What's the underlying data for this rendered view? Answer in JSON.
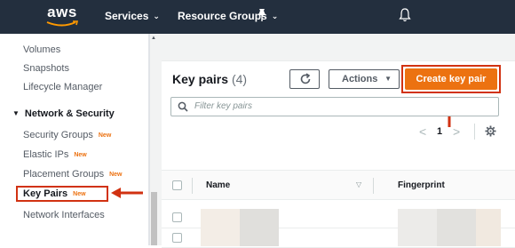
{
  "topnav": {
    "logo_text": "aws",
    "services_label": "Services",
    "resource_groups_label": "Resource Groups",
    "caret": "⌄",
    "background": "#232f3e",
    "pin_icon": "pin-icon",
    "bell_icon": "bell-icon"
  },
  "sidebar": {
    "items_top": [
      "Volumes",
      "Snapshots",
      "Lifecycle Manager"
    ],
    "section_label": "Network & Security",
    "section_toggle": "▼",
    "security_groups": {
      "label": "Security Groups",
      "badge": "New"
    },
    "elastic_ips": {
      "label": "Elastic IPs",
      "badge": "New"
    },
    "placement_groups": {
      "label": "Placement Groups",
      "badge": "New"
    },
    "key_pairs": {
      "label": "Key Pairs",
      "badge": "New"
    },
    "network_interfaces": {
      "label": "Network Interfaces"
    },
    "highlight_color": "#d13212"
  },
  "panel": {
    "title": "Key pairs",
    "count": "(4)",
    "actions_label": "Actions",
    "actions_arrow": "▼",
    "create_label": "Create key pair",
    "create_color": "#ec7211",
    "filter_placeholder": "Filter key pairs",
    "pager": {
      "prev": "<",
      "page": "1",
      "next": ">"
    },
    "columns": [
      "Name",
      "Fingerprint"
    ],
    "sort_indicator": "▽"
  }
}
